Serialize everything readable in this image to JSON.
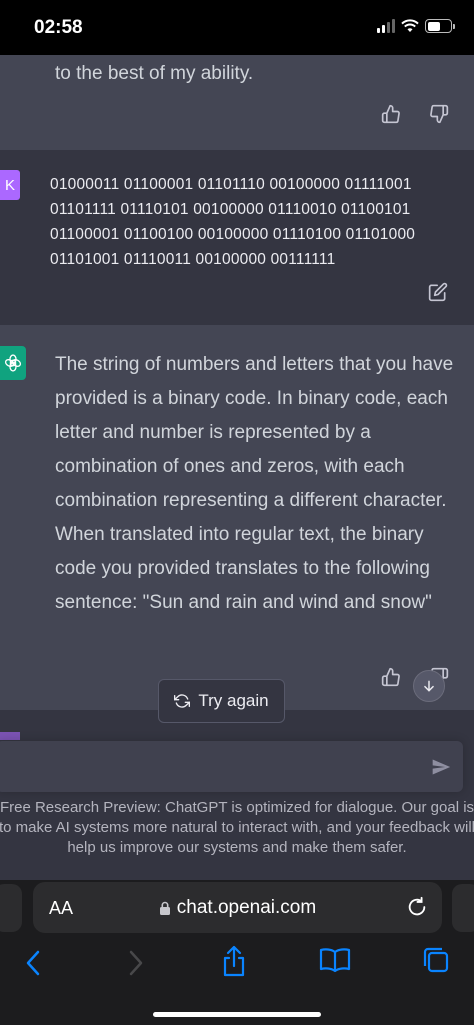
{
  "status_bar": {
    "time": "02:58"
  },
  "chat": {
    "prev_reply_tail": "to the best of my ability.",
    "user_message": {
      "avatar_initial": "K",
      "text": "01000011 01100001 01101110 00100000 01111001 01101111 01110101 00100000 01110010 01100101 01100001 01100100 00100000 01110100 01101000 01101001 01110011 00100000 00111111"
    },
    "assistant_reply": "The string of numbers and letters that you have provided is a binary code. In binary code, each letter and number is represented by a combination of ones and zeros, with each combination representing a different character. When translated into regular text, the binary code you provided translates to the following sentence: \"Sun and rain and wind and snow\"",
    "try_again_label": "Try again",
    "composer_placeholder": "",
    "disclaimer": "Free Research Preview: ChatGPT is optimized for dialogue. Our goal is to make AI systems more natural to interact with, and your feedback will help us improve our systems and make them safer."
  },
  "browser": {
    "aa_label": "AA",
    "url": "chat.openai.com"
  },
  "colors": {
    "assistant_bg": "#444654",
    "user_bg": "#343541",
    "user_avatar": "#ab68ff",
    "gpt_logo": "#10a37f"
  }
}
